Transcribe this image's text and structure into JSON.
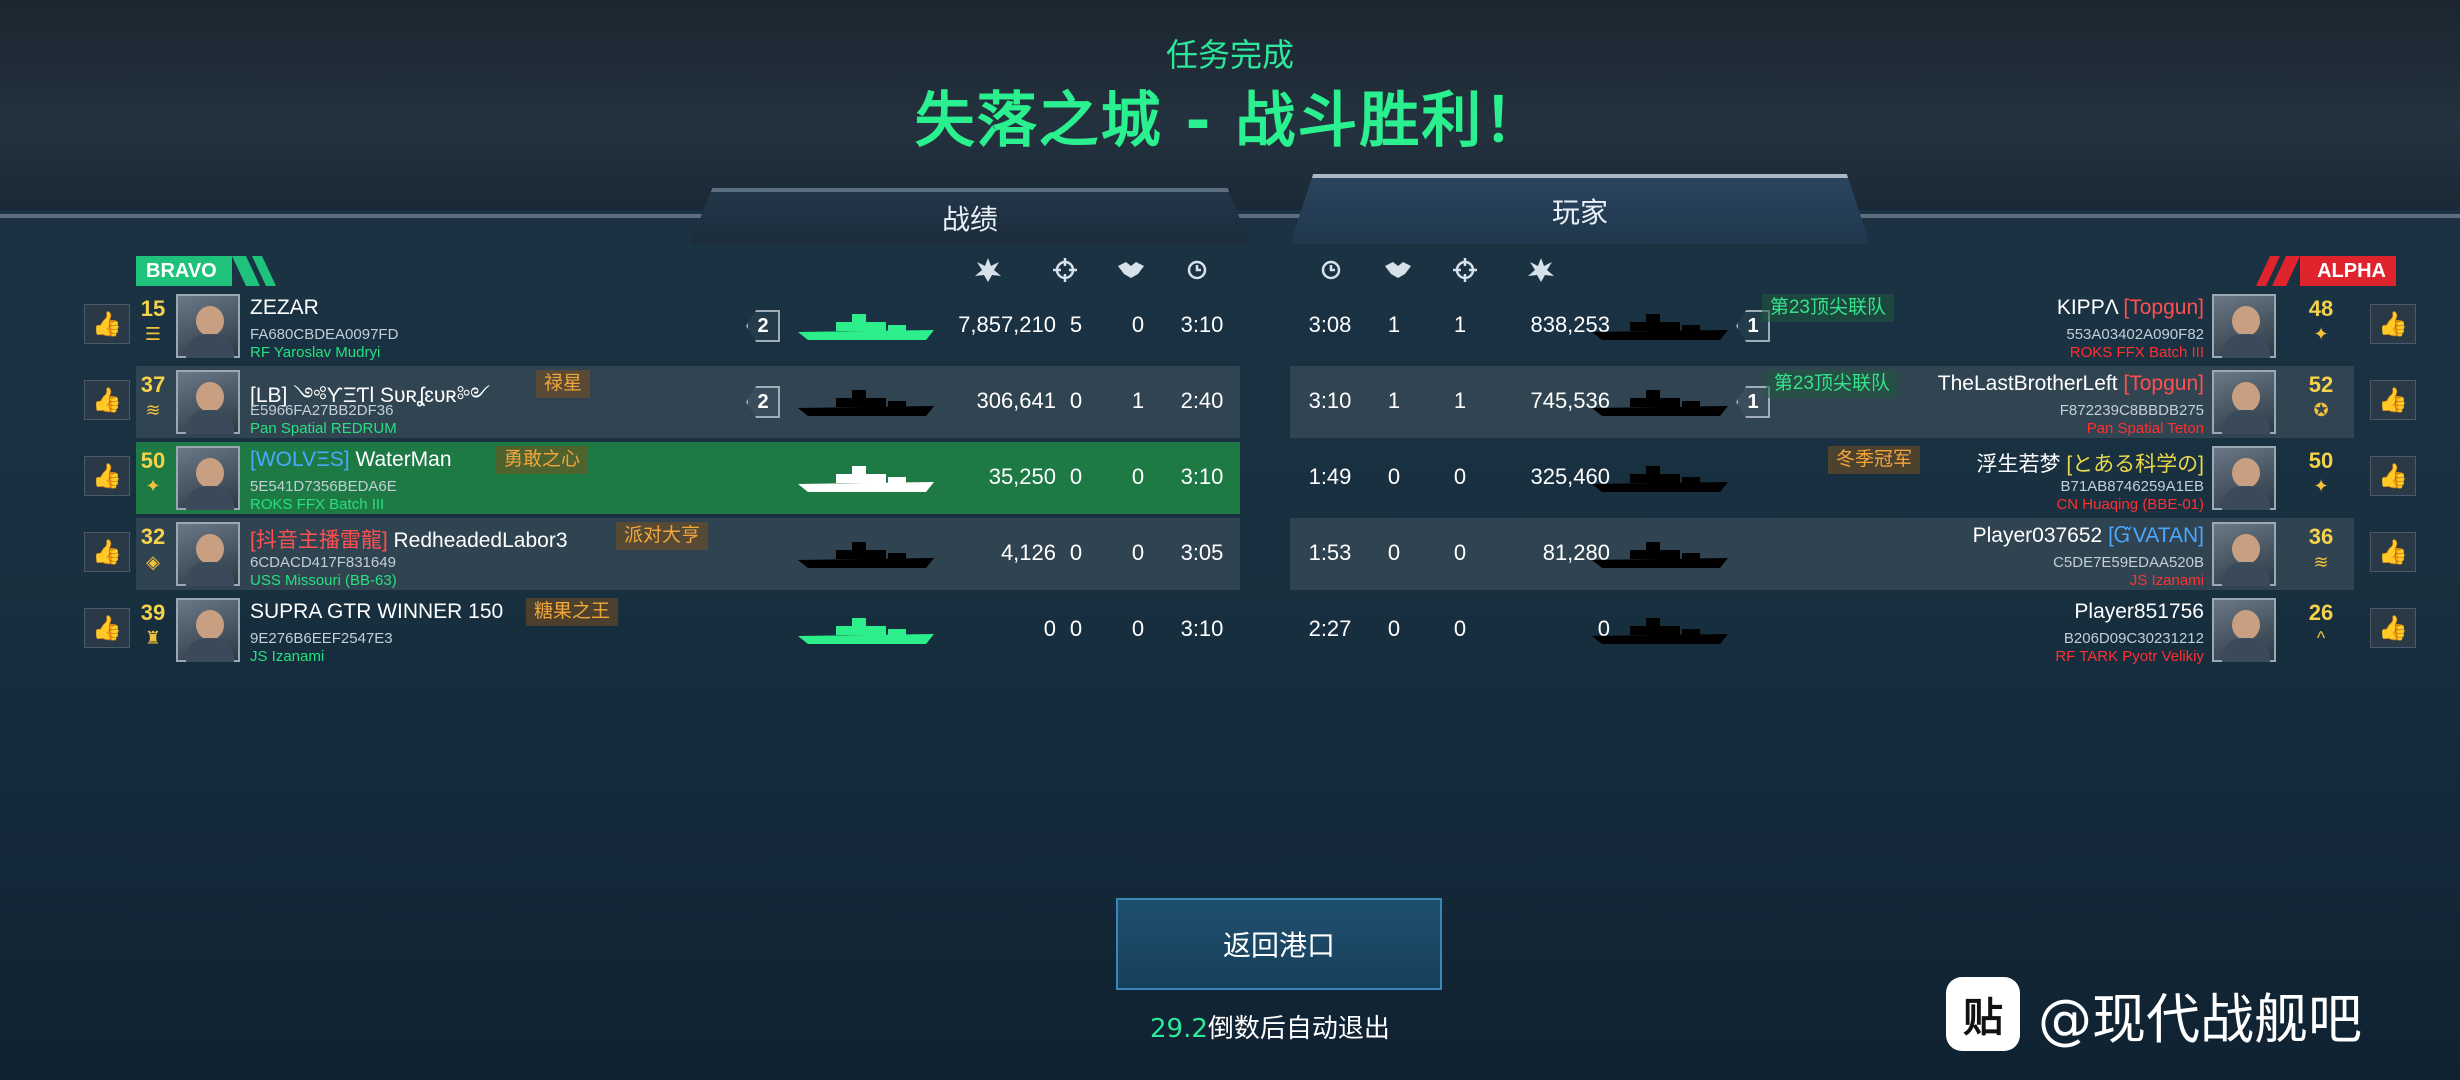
{
  "header": {
    "subtitle": "任务完成",
    "title": "失落之城 - 战斗胜利！"
  },
  "tabs": [
    {
      "label": "战绩"
    },
    {
      "label": "玩家"
    }
  ],
  "teams": {
    "left": "BRAVO",
    "right": "ALPHA"
  },
  "icons": {
    "like": "thumbs-up-icon",
    "damage": "explosion-icon",
    "kills": "crosshair-icon",
    "assists": "handshake-icon",
    "time": "clock-icon"
  },
  "left_players": [
    {
      "level": "15",
      "rank": "☰",
      "name": "ZEZAR",
      "clan": "",
      "tag": "",
      "id": "FA680CBDEA0097FD",
      "ship": "RF Yaroslav Mudryi",
      "kills_badge": "2",
      "damage": "7,857,210",
      "kills": "5",
      "assists": "0",
      "time": "3:10",
      "ship_color": "#2cef8c"
    },
    {
      "level": "37",
      "rank": "≋",
      "name": "༺ƳΞƬƖ Sᴜʀʆɛᴜʀ༻",
      "clan": "[LB] ",
      "tag": "禄星",
      "id": "E5966FA27BB2DF36",
      "ship": "Pan Spatial REDRUM",
      "kills_badge": "2",
      "damage": "306,641",
      "kills": "0",
      "assists": "1",
      "time": "2:40",
      "ship_color": "#000000"
    },
    {
      "level": "50",
      "rank": "✦",
      "name": "WaterMan",
      "clan": "[WOLVΞS] ",
      "tag": "勇敢之心",
      "id": "5E541D7356BEDA6E",
      "ship": "ROKS FFX Batch III",
      "kills_badge": "",
      "damage": "35,250",
      "kills": "0",
      "assists": "0",
      "time": "3:10",
      "ship_color": "#ffffff"
    },
    {
      "level": "32",
      "rank": "◈",
      "name": "RedheadedLabor3",
      "clan": "[抖音主播雷龍] ",
      "tag": "派对大亨",
      "id": "6CDACD417F831649",
      "ship": "USS Missouri (BB-63)",
      "kills_badge": "",
      "damage": "4,126",
      "kills": "0",
      "assists": "0",
      "time": "3:05",
      "ship_color": "#000000"
    },
    {
      "level": "39",
      "rank": "♜",
      "name": "SUPRA GTR WINNER 150",
      "clan": "",
      "tag": "糖果之王",
      "id": "9E276B6EEF2547E3",
      "ship": "JS Izanami",
      "kills_badge": "",
      "damage": "0",
      "kills": "0",
      "assists": "0",
      "time": "3:10",
      "ship_color": "#2cef8c"
    }
  ],
  "right_players": [
    {
      "level": "48",
      "rank": "✦",
      "name": "KIPPΛ",
      "clan": "[Topgun]",
      "tag": "第23顶尖联队",
      "id": "553A03402A090F82",
      "ship": "ROKS FFX Batch III",
      "kills_badge": "1",
      "damage": "838,253",
      "kills": "1",
      "assists": "1",
      "time": "3:08"
    },
    {
      "level": "52",
      "rank": "✪",
      "name": "TheLastBrotherLeft",
      "clan": "[Topgun]",
      "tag": "第23顶尖联队",
      "id": "F872239C8BBDB275",
      "ship": "Pan Spatial Teton",
      "kills_badge": "1",
      "damage": "745,536",
      "kills": "1",
      "assists": "1",
      "time": "3:10"
    },
    {
      "level": "50",
      "rank": "✦",
      "name": "浮生若梦",
      "clan": "[とある科学の]",
      "tag": "冬季冠军",
      "id": "B71AB8746259A1EB",
      "ship": "CN Huaqing (BBE-01)",
      "kills_badge": "",
      "damage": "325,460",
      "kills": "0",
      "assists": "0",
      "time": "1:49"
    },
    {
      "level": "36",
      "rank": "≋",
      "name": "Player037652",
      "clan": "[ᏳVATAN]",
      "tag": "",
      "id": "C5DE7E59EDAA520B",
      "ship": "JS Izanami",
      "kills_badge": "",
      "damage": "81,280",
      "kills": "0",
      "assists": "0",
      "time": "1:53"
    },
    {
      "level": "26",
      "rank": "^",
      "name": "Player851756",
      "clan": "",
      "tag": "",
      "id": "B206D09C30231212",
      "ship": "RF TARK Pyotr Velikiy",
      "kills_badge": "",
      "damage": "0",
      "kills": "0",
      "assists": "0",
      "time": "2:27"
    }
  ],
  "footer": {
    "return_label": "返回港口",
    "countdown_value": "29.2",
    "countdown_text": "倒数后自动退出"
  },
  "watermark": {
    "icon": "贴",
    "text": "@现代战舰吧"
  }
}
